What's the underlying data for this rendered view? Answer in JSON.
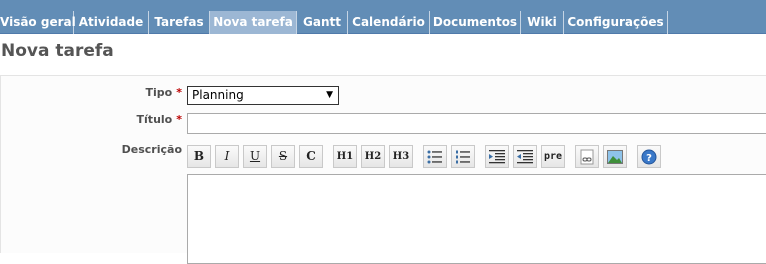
{
  "tabs": [
    {
      "label": "Visão geral"
    },
    {
      "label": "Atividade"
    },
    {
      "label": "Tarefas"
    },
    {
      "label": "Nova tarefa",
      "selected": true
    },
    {
      "label": "Gantt"
    },
    {
      "label": "Calendário"
    },
    {
      "label": "Documentos"
    },
    {
      "label": "Wiki"
    },
    {
      "label": "Configurações"
    }
  ],
  "page": {
    "title": "Nova tarefa"
  },
  "form": {
    "tipo_label": "Tipo",
    "tipo_value": "Planning",
    "titulo_label": "Título",
    "descricao_label": "Descrição",
    "required_mark": "*"
  },
  "toolbar": {
    "bold": "B",
    "italic": "I",
    "underline": "U",
    "strike": "S",
    "code": "C",
    "h1": "H1",
    "h2": "H2",
    "h3": "H3",
    "pre": "pre"
  },
  "colors": {
    "tab_bar": "#628DB6",
    "tab_selected": "#9cb7d4",
    "required": "#bb0000"
  }
}
